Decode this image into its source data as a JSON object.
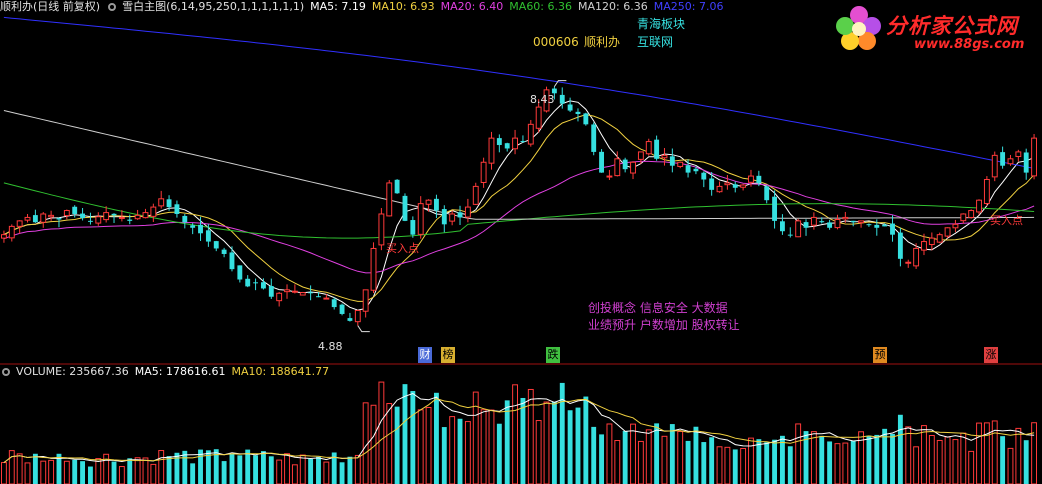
{
  "header": {
    "stock_name": "顺利办",
    "period": "(日线 前复权)",
    "indicator": "雪白主图(6,14,95,250,1,1,1,1,1,1)",
    "ma5": "MA5: 7.19",
    "ma10": "MA10: 6.93",
    "ma20": "MA20: 6.40",
    "ma60": "MA60: 6.36",
    "ma120": "MA120: 6.36",
    "ma250": "MA250: 7.06"
  },
  "info": {
    "code": "000606",
    "name": "顺利办",
    "sector1": "青海板块",
    "sector2": "互联网"
  },
  "concepts": {
    "line1": "创投概念 信息安全 大数据",
    "line2": "业绩预升 户数增加 股权转让"
  },
  "markers": {
    "high_label": "8.43",
    "low_label": "4.88",
    "buy_label": "买入点",
    "buy_label_right": "买入点"
  },
  "events": [
    {
      "text": "财",
      "color": "#4a6ad8"
    },
    {
      "text": "榜",
      "color": "#d8b030"
    },
    {
      "text": "跌",
      "color": "#40c040"
    },
    {
      "text": "预",
      "color": "#e08a20"
    },
    {
      "text": "涨",
      "color": "#e04040"
    }
  ],
  "volume_header": {
    "label": "VOLUME: 235667.36",
    "ma5": "MA5: 178616.61",
    "ma10": "MA10: 188641.77"
  },
  "logo": {
    "title": "分析家公式网",
    "url": "www.88gs.com"
  },
  "colors": {
    "up": "#ff3a3a",
    "down": "#36e0e0",
    "ma5": "#ffffff",
    "ma10": "#f0d040",
    "ma20": "#e040e0",
    "ma60": "#30c030",
    "ma120": "#d0d0d0",
    "ma250": "#3030ff",
    "concept": "#d040d0"
  },
  "chart_data": {
    "type": "candlestick",
    "price_range": [
      4.6,
      9.4
    ],
    "price_high": 8.43,
    "price_low": 4.88,
    "volume_max": 400000,
    "series": [
      {
        "name": "MA5",
        "last": 7.19
      },
      {
        "name": "MA10",
        "last": 6.93
      },
      {
        "name": "MA20",
        "last": 6.4
      },
      {
        "name": "MA60",
        "last": 6.36
      },
      {
        "name": "MA120",
        "last": 6.36
      },
      {
        "name": "MA250",
        "last": 7.06
      }
    ],
    "volume_series": [
      {
        "name": "VOLUME",
        "last": 235667.36
      },
      {
        "name": "MA5",
        "last": 178616.61
      },
      {
        "name": "MA10",
        "last": 188641.77
      }
    ],
    "closes": [
      6.2,
      6.32,
      6.4,
      6.45,
      6.38,
      6.5,
      6.48,
      6.42,
      6.55,
      6.5,
      6.44,
      6.4,
      6.46,
      6.52,
      6.48,
      6.45,
      6.4,
      6.48,
      6.52,
      6.6,
      6.72,
      6.6,
      6.5,
      6.38,
      6.3,
      6.22,
      6.1,
      6.0,
      5.92,
      5.7,
      5.55,
      5.45,
      5.5,
      5.42,
      5.3,
      5.35,
      5.4,
      5.38,
      5.36,
      5.35,
      5.3,
      5.28,
      5.15,
      5.05,
      4.95,
      5.1,
      5.4,
      6.0,
      6.5,
      6.95,
      6.8,
      6.4,
      6.2,
      6.65,
      6.7,
      6.55,
      6.35,
      6.5,
      6.45,
      6.6,
      6.9,
      7.25,
      7.6,
      7.5,
      7.45,
      7.6,
      7.55,
      7.8,
      8.05,
      8.3,
      8.25,
      8.1,
      8.0,
      7.95,
      7.8,
      7.4,
      7.1,
      7.05,
      7.3,
      7.15,
      7.25,
      7.4,
      7.55,
      7.3,
      7.35,
      7.2,
      7.25,
      7.1,
      7.12,
      7.0,
      6.85,
      6.9,
      6.95,
      6.88,
      6.92,
      7.05,
      6.95,
      6.7,
      6.4,
      6.25,
      6.2,
      6.4,
      6.3,
      6.45,
      6.38,
      6.3,
      6.42,
      6.45,
      6.38,
      6.4,
      6.35,
      6.3,
      6.32,
      6.2,
      5.85,
      5.8,
      6.0,
      6.1,
      6.15,
      6.2,
      6.3,
      6.35,
      6.5,
      6.55,
      6.7,
      7.0,
      7.35,
      7.2,
      7.3,
      7.4,
      7.1,
      7.6
    ]
  }
}
